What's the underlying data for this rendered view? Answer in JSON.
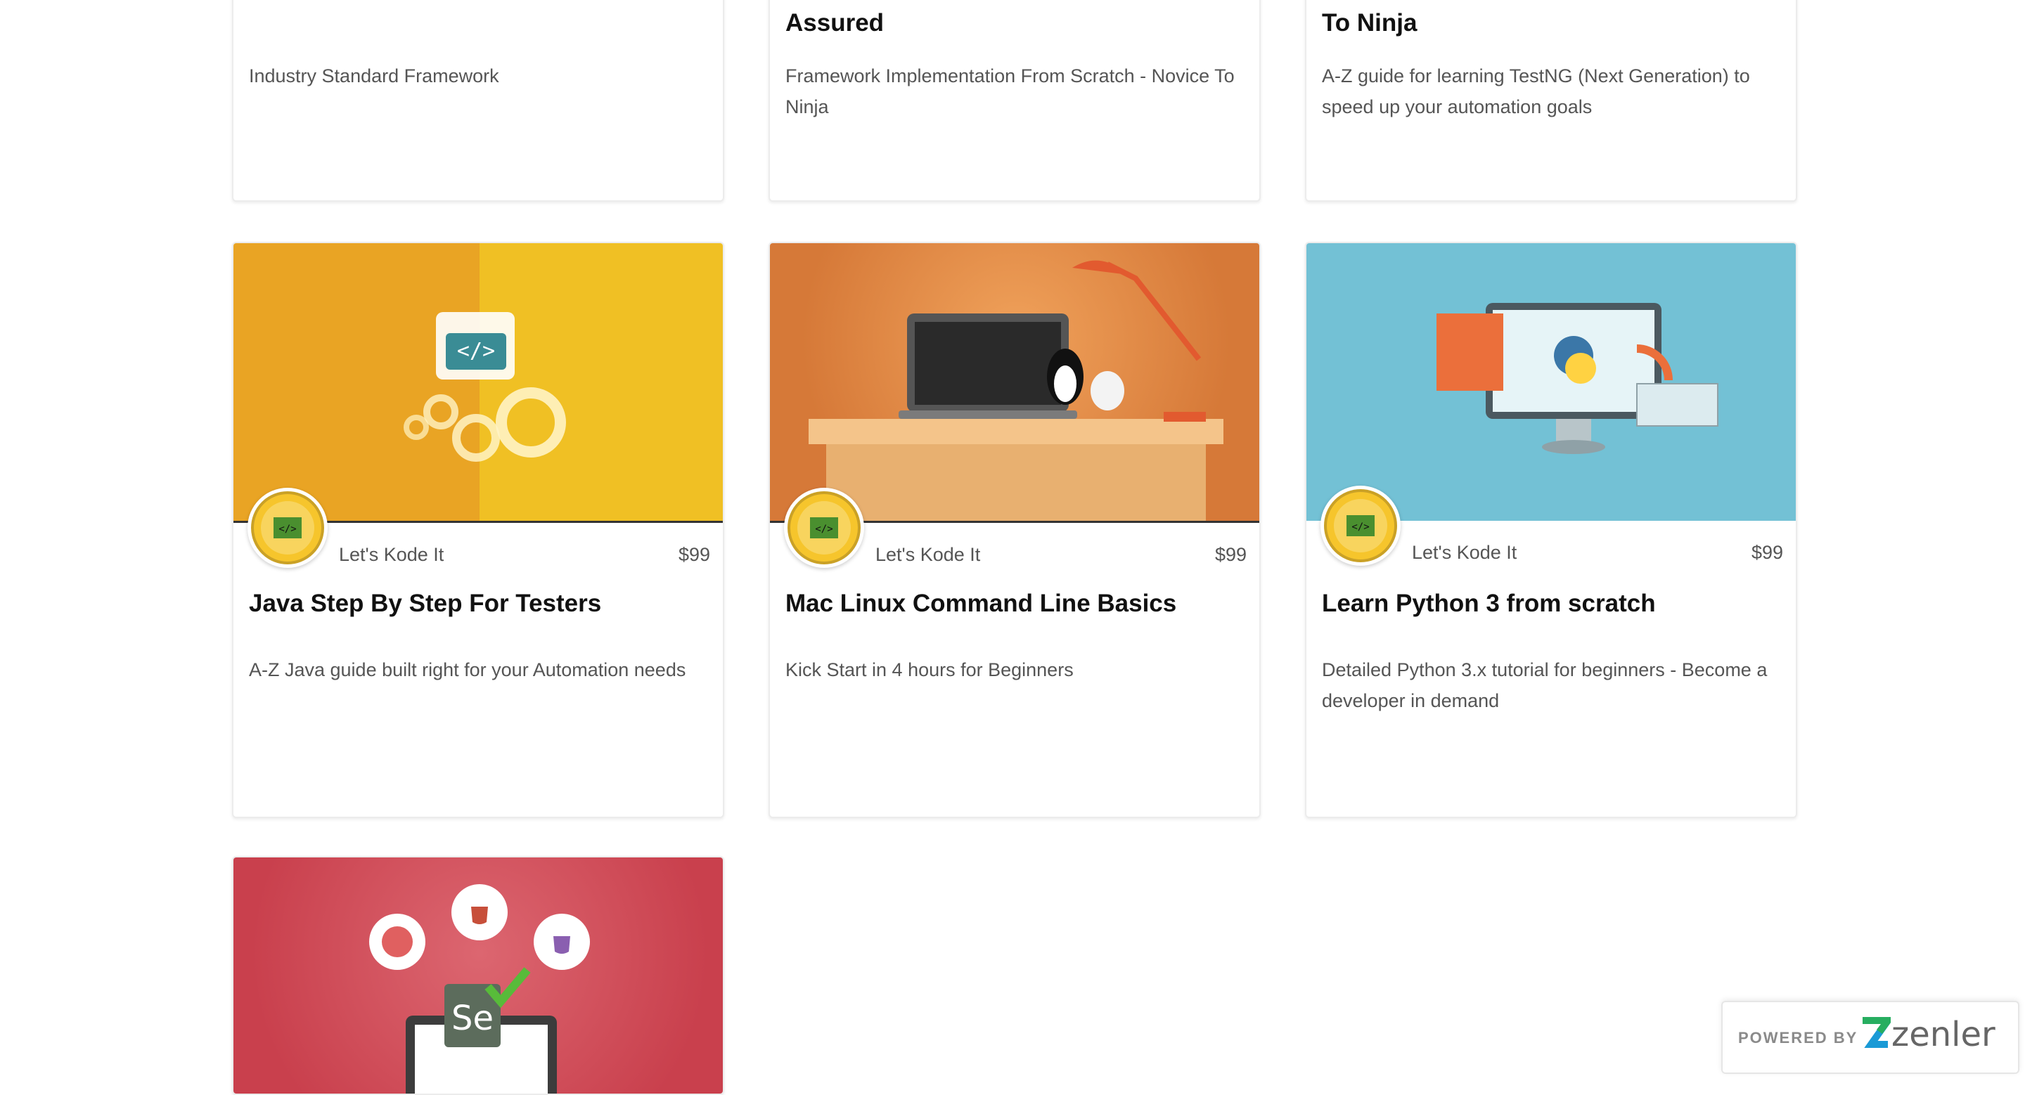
{
  "top_cards": [
    {
      "title_tail": "",
      "subtitle": "Industry Standard Framework"
    },
    {
      "title_tail": "Assured",
      "subtitle": "Framework Implementation From Scratch - Novice To Ninja"
    },
    {
      "title_tail": "To Ninja",
      "subtitle": "A-Z guide for learning TestNG (Next Generation) to speed up your automation goals"
    }
  ],
  "mid_cards": [
    {
      "author": "Let's Kode It",
      "price": "$99",
      "title": "Java Step By Step For Testers",
      "subtitle": "A-Z Java guide built right for your Automation needs",
      "thumb_color": "#ebb01e"
    },
    {
      "author": "Let's Kode It",
      "price": "$99",
      "title": "Mac Linux Command Line Basics",
      "subtitle": "Kick Start in 4 hours for Beginners",
      "thumb_color": "#d8793a"
    },
    {
      "author": "Let's Kode It",
      "price": "$99",
      "title": "Learn Python 3 from scratch",
      "subtitle": "Detailed Python 3.x tutorial for beginners - Become a developer in demand",
      "thumb_color": "#73c1d5"
    }
  ],
  "bottom_card": {
    "thumb_color": "#cf4b55",
    "icon_text": "Se"
  },
  "badge": {
    "powered_by": "POWERED BY",
    "brand": "zenler"
  }
}
